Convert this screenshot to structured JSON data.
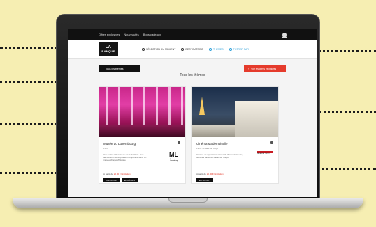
{
  "screen": {
    "topbar": {
      "links": [
        "Offres exclusives",
        "Nouveautés",
        "Bons cadeaux"
      ]
    },
    "navbar": {
      "logo_top": "LA BANQUE",
      "logo_bottom": "BANQUE",
      "items": [
        {
          "label": "SÉLECTION DU MOMENT",
          "icon": "eye-icon"
        },
        {
          "label": "DESTINATIONS",
          "icon": "map-icon"
        },
        {
          "label": "THÈMES",
          "icon": "tag-icon",
          "active": true
        },
        {
          "label": "FILTRER PAR",
          "icon": "filter-icon"
        }
      ]
    },
    "back_button": "Tous les thèmes",
    "red_button": "Voir les offres exclusives",
    "section_title": "Tous les thèmes",
    "cards": [
      {
        "title": "Musée du Luxembourg",
        "subtitle": "Paris",
        "description": "Une sortie culturelle au cœur de Paris. Une découverte de l'exposition temporaire dans un musée chargé d'histoire.",
        "meta_prefix": "À partir de",
        "meta_link": "25,00 € l'invitation",
        "partner": "ML",
        "partner_text": "Musée du Luxembourg",
        "actions": [
          "INVITATIONS",
          "EN DÉTAILS"
        ]
      },
      {
        "title": "Cinéma Mademoiselle",
        "subtitle": "Paris – Palais de Tokyo",
        "description": "Cinéma et expositions autour du thème de la ville, dans les salles du Palais de Tokyo.",
        "meta_prefix": "À partir de",
        "meta_link": "20,00 € l'invitation",
        "partner_text": "PALAIS DE TOKYO",
        "actions": [
          "EN SAVOIR +"
        ]
      }
    ]
  }
}
